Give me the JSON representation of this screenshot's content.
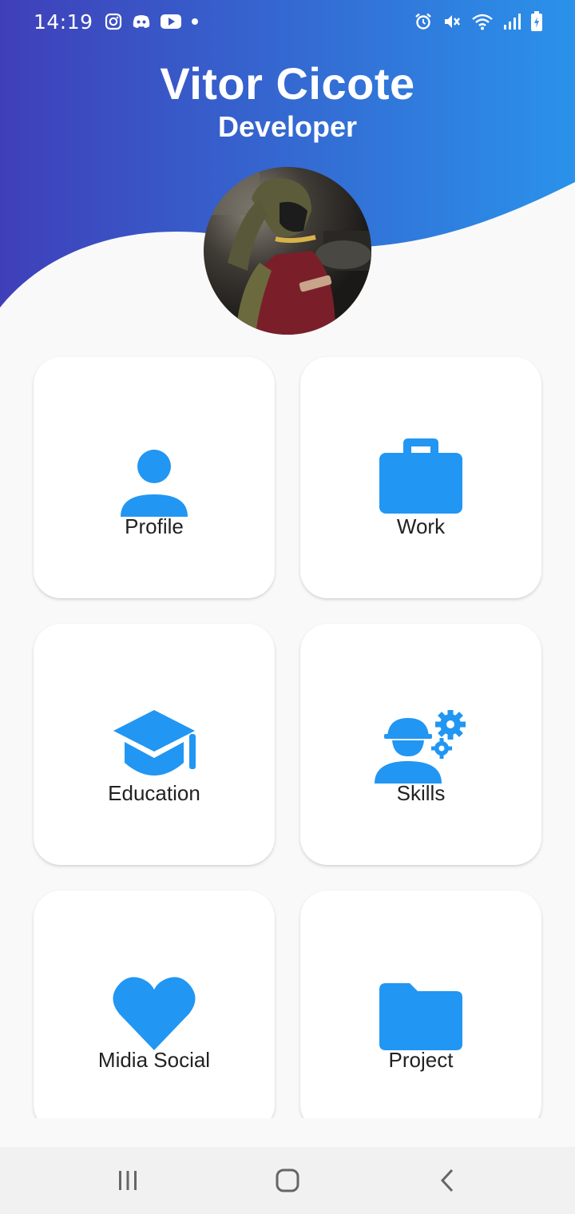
{
  "status_bar": {
    "time": "14:19",
    "left_icons": [
      "instagram-icon",
      "discord-icon",
      "youtube-icon",
      "dot-icon"
    ],
    "right_icons": [
      "alarm-icon",
      "mute-icon",
      "wifi-icon",
      "signal-icon",
      "battery-icon"
    ]
  },
  "profile": {
    "name": "Vitor Cicote",
    "role": "Developer"
  },
  "colors": {
    "gradient_start": "#3F3FB9",
    "gradient_end": "#2A92EA",
    "icon_blue": "#2196F3",
    "background": "#F9F9F9"
  },
  "menu": {
    "items": [
      {
        "label": "Profile",
        "icon": "person-icon"
      },
      {
        "label": "Work",
        "icon": "briefcase-icon"
      },
      {
        "label": "Education",
        "icon": "graduation-cap-icon"
      },
      {
        "label": "Skills",
        "icon": "engineer-gears-icon"
      },
      {
        "label": "Midia Social",
        "icon": "heart-icon"
      },
      {
        "label": "Project",
        "icon": "folder-icon"
      }
    ]
  },
  "nav": {
    "buttons": [
      "recent-apps",
      "home",
      "back"
    ]
  }
}
